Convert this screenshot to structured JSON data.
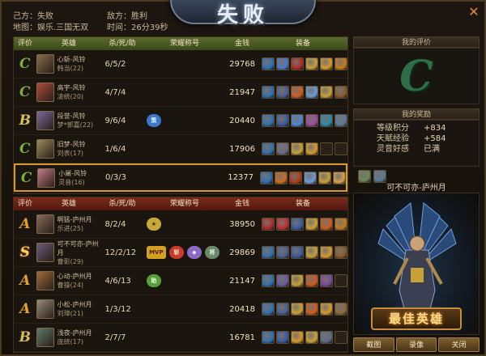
{
  "header": {
    "title": "失败",
    "self_side": "己方：失败",
    "enemy_side": "敌方：胜利",
    "map": "地图：娱乐.三国无双",
    "time": "时间：26分39秒"
  },
  "columns": [
    "评价",
    "英雄",
    "杀/死/助",
    "荣耀称号",
    "金钱",
    "装备"
  ],
  "own_team": [
    {
      "grade": "C",
      "name": "心斩-风铃",
      "hero": "韩当(22)",
      "kda": "6/5/2",
      "gold": "29768",
      "honors": [],
      "portrait_color": "#8a6a4a",
      "items": [
        "#2f6fb0",
        "#4a78c8",
        "#b02a2a",
        "#c8a038",
        "#d69a2a",
        "#c87a1a"
      ]
    },
    {
      "grade": "C",
      "name": "高宇-风铃",
      "hero": "凌统(20)",
      "kda": "4/7/4",
      "gold": "21947",
      "honors": [],
      "portrait_color": "#b04a3a",
      "items": [
        "#2f6fb0",
        "#4a5e90",
        "#d05a20",
        "#6a9ad6",
        "#c8a038",
        "#8a5a2a"
      ]
    },
    {
      "grade": "B",
      "name": "段誉-风铃",
      "hero": "梦*郭嘉(22)",
      "kda": "9/6/4",
      "gold": "20440",
      "honors": [
        {
          "label": "策",
          "color": "#3a78c8",
          "text_color": "#e0ecff"
        }
      ],
      "portrait_color": "#7a6a9a",
      "items": [
        "#2f6fb0",
        "#3a5aa0",
        "#4a88d8",
        "#a04aa0",
        "#2a8ab0",
        "#5a7a9a"
      ]
    },
    {
      "grade": "C",
      "name": "旧梦-风铃",
      "hero": "刘表(17)",
      "kda": "1/6/4",
      "gold": "17906",
      "honors": [],
      "portrait_color": "#9a8a5a",
      "items": [
        "#2f6fb0",
        "#6a6a8a",
        "#c8a038",
        "#d69a2a",
        "",
        ""
      ]
    },
    {
      "grade": "C",
      "name": "小屠-风铃",
      "hero": "灵音(16)",
      "kda": "0/3/3",
      "gold": "12377",
      "honors": [],
      "portrait_color": "#c87a8a",
      "items": [
        "#2f6fb0",
        "#d06a1a",
        "#b03a1a",
        "#6a9ad6",
        "#c8a038",
        "#d6a050"
      ]
    }
  ],
  "enemy_team": [
    {
      "grade": "A",
      "name": "啊猛-庐州月",
      "hero": "乐进(25)",
      "kda": "8/2/4",
      "gold": "38950",
      "honors": [
        {
          "label": "★",
          "color": "#c8a838",
          "text_color": "#3a2a0a"
        }
      ],
      "portrait_color": "#8a6a5a",
      "items": [
        "#b02a2a",
        "#c03030",
        "#3a5aa0",
        "#c8a038",
        "#d05a20",
        "#c87a1a"
      ]
    },
    {
      "grade": "S",
      "name": "可不可亦-庐州月",
      "hero": "曹彰(29)",
      "kda": "12/2/12",
      "gold": "29869",
      "honors": [
        {
          "label": "MVP",
          "color": "#d4a020",
          "text_color": "#5a1a0a"
        },
        {
          "label": "斩",
          "color": "#c83a2a",
          "text_color": "#fff2d0"
        },
        {
          "label": "◆",
          "color": "#8a6ac8",
          "text_color": "#f0e6ff"
        },
        {
          "label": "将",
          "color": "#6a8a6a",
          "text_color": "#e6f2e0"
        }
      ],
      "portrait_color": "#6a5a7a",
      "items": [
        "#2f6fb0",
        "#4a5e90",
        "#3a5aa0",
        "#c8a038",
        "#d69a2a",
        "#8a5a2a"
      ]
    },
    {
      "grade": "A",
      "name": "心动-庐州月",
      "hero": "曹操(24)",
      "kda": "4/6/13",
      "gold": "21147",
      "honors": [
        {
          "label": "助",
          "color": "#5aa03a",
          "text_color": "#eaffdc"
        }
      ],
      "portrait_color": "#a06a3a",
      "items": [
        "#2f6fb0",
        "#6a5aa0",
        "#c8a038",
        "#d05a20",
        "#7a4a9a",
        ""
      ]
    },
    {
      "grade": "A",
      "name": "小松-庐州月",
      "hero": "刘璋(21)",
      "kda": "1/3/12",
      "gold": "20418",
      "honors": [],
      "portrait_color": "#9a8a7a",
      "items": [
        "#2f6fb0",
        "#4a5e90",
        "#c8a038",
        "#d05a20",
        "#d69a2a",
        "#8a6a3a"
      ]
    },
    {
      "grade": "B",
      "name": "浅夜-庐州月",
      "hero": "庞统(17)",
      "kda": "2/7/7",
      "gold": "16781",
      "honors": [],
      "portrait_color": "#5a7a6a",
      "items": [
        "#2f6fb0",
        "#3a5aa0",
        "#d69a2a",
        "#c8a038",
        "#5a6a8a",
        ""
      ]
    }
  ],
  "my_eval": {
    "title": "我的评价",
    "grade": "C"
  },
  "my_reward": {
    "title": "我的奖励",
    "rows": [
      {
        "label": "等级积分",
        "value": "+834"
      },
      {
        "label": "天赋经验",
        "value": "+584"
      },
      {
        "label": "灵音好感",
        "value": "已满"
      }
    ],
    "item_colors": [
      "#6a8a5a",
      "#5a7a9a"
    ]
  },
  "mvp": {
    "player": "可不可亦-庐州月",
    "badge": "最佳英雄"
  },
  "buttons": {
    "screenshot": "截图",
    "replay": "录像",
    "close": "关闭"
  }
}
